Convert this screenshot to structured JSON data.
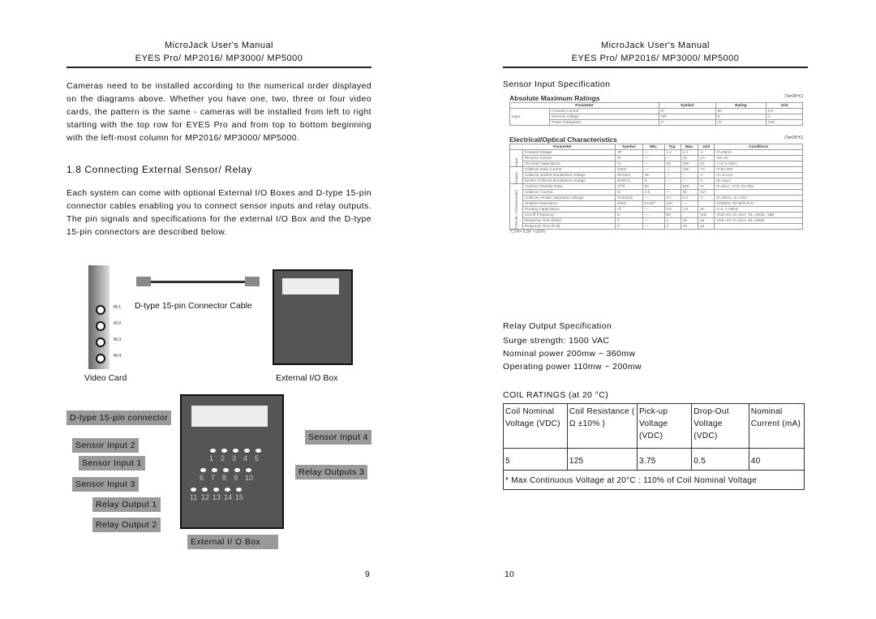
{
  "header": {
    "line1": "MicroJack User's Manual",
    "line2": "EYES Pro/ MP2016/ MP3000/ MP5000"
  },
  "left": {
    "intro": "Cameras need to be installed according to the numerical order displayed on the diagrams above.  Whether you have one, two, three or four video cards, the pattern is the same - cameras will be installed from left to right starting with the top row for EYES Pro and from top to bottom beginning with the left-most column for MP2016/ MP3000/ MP5000.",
    "section": "1.8 Connecting External Sensor/ Relay",
    "body": "Each system can come with optional External I/O Boxes and D-type 15-pin connector cables enabling you to connect sensor inputs and relay outputs.  The pin signals and specifications for the external I/O Box and the D-type 15-pin connectors are described below.",
    "fig1": {
      "cable": "D-type 15-pin Connector Cable",
      "video_card": "Video Card",
      "io_box": "External I/O Box",
      "ports": [
        "IN 1",
        "IN 2",
        "IN 3",
        "IN 4"
      ]
    },
    "fig2": {
      "labels": [
        "D-type 15-pin connector",
        "Sensor Input 2",
        "Sensor Input 1",
        "Sensor Input 3",
        "Relay Output 1",
        "Relay Output 2",
        "Sensor Input 4",
        "Relay Outputs 3",
        "External I/ O Box"
      ],
      "pins": [
        [
          "1",
          "2",
          "3",
          "4",
          "5"
        ],
        [
          "6",
          "7",
          "8",
          "9",
          "10"
        ],
        [
          "11",
          "12",
          "13",
          "14",
          "15"
        ]
      ]
    },
    "page_number": "9"
  },
  "right": {
    "sensor_title": "Sensor Input Specification",
    "abs": {
      "title": "Absolute Maximum Ratings",
      "cond": "(Ta=25℃)",
      "headers": [
        "Parameter",
        "Symbol",
        "Rating",
        "Unit"
      ],
      "group": "Input",
      "rows": [
        [
          "Forward Current",
          "IF",
          "50",
          "mA"
        ],
        [
          "Reverse Voltage",
          "VR",
          "6",
          "V"
        ],
        [
          "Power Dissipation",
          "P",
          "70",
          "mW"
        ]
      ]
    },
    "eo": {
      "title": "Electrical/Optical Characteristics",
      "cond": "(Ta=25℃)",
      "headers": [
        "Parameter",
        "Symbol",
        "Min.",
        "Typ.",
        "Max.",
        "Unit",
        "Conditions"
      ],
      "groups": [
        {
          "name": "Input",
          "rows": [
            [
              "Forward Voltage",
              "VF",
              "—",
              "1.2",
              "1.4",
              "V",
              "IF=20mA"
            ],
            [
              "Reverse Current",
              "IR",
              "—",
              "—",
              "10",
              "μA",
              "VR=4V"
            ],
            [
              "Terminal Capacitance",
              "Ct",
              "—",
              "30",
              "250",
              "pF",
              "V=0, f=1kHz"
            ]
          ]
        },
        {
          "name": "Output",
          "rows": [
            [
              "Collector Dark Current",
              "ICEO",
              "—",
              "—",
              "100",
              "nA",
              "VCE=20V"
            ],
            [
              "Collector-Emitter Breakdown Voltage",
              "BVCEO",
              "35",
              "—",
              "—",
              "V",
              "IC=0.1mA"
            ],
            [
              "Emitter-Collector Breakdown Voltage",
              "BVECO",
              "6",
              "—",
              "—",
              "V",
              "IE=10μA"
            ]
          ]
        },
        {
          "name": "Transfer Characteristics",
          "rows": [
            [
              "*Current Transfer Ratio",
              "CTR",
              "50",
              "—",
              "600",
              "%",
              "IF=5mA, VCE=5V Rbe"
            ],
            [
              "Collector Current",
              "IC",
              "2.5",
              "—",
              "30",
              "mA",
              ""
            ],
            [
              "Collector-emitter Saturation Voltage",
              "VCE(sat)",
              "—",
              "0.1",
              "0.2",
              "V",
              "IF=20mA, IC=1mA"
            ],
            [
              "Isolation Resistance",
              "RISO",
              "5×10¹⁰",
              "10¹¹",
              "—",
              "",
              "DC500V, 40~60% R.H."
            ],
            [
              "Floating Capacitance",
              "Cf",
              "—",
              "0.6",
              "1.0",
              "pF",
              "V=0, f=1MHz"
            ],
            [
              "Cut-off Frequency",
              "fc",
              "—",
              "80",
              "",
              "kHz",
              "VCE=5V, IC=2mA, RL=100Ω, -3dB"
            ],
            [
              "Response Time (Rise)",
              "tr",
              "—",
              "4",
              "18",
              "μs",
              "VCE=2V, IC=2mA, RL=100Ω"
            ],
            [
              "Response Time (Fall)",
              "tf",
              "—",
              "3",
              "18",
              "μs",
              ""
            ]
          ]
        }
      ],
      "note": "*CTR= IC/IF ×100%"
    },
    "relay_title": "Relay Output Specification",
    "relay_lines": [
      "Surge strength: 1500 VAC",
      "Nominal power 200mw ~ 360mw",
      "Operating power 110mw ~ 200mw"
    ],
    "coil": {
      "title": "COIL RATINGS (at 20 °C)",
      "headers": [
        "Coil Nominal Voltage (VDC)",
        "Coil Resistance ( Ω ±10% )",
        "Pick-up Voltage (VDC)",
        "Drop-Out Voltage (VDC)",
        "Nominal Current (mA)"
      ],
      "row": [
        "5",
        "125",
        "3.75",
        "0.5",
        "40"
      ],
      "note": "* Max Continuous Voltage at 20°C : 110% of Coil Nominal Voltage"
    },
    "page_number": "10"
  }
}
